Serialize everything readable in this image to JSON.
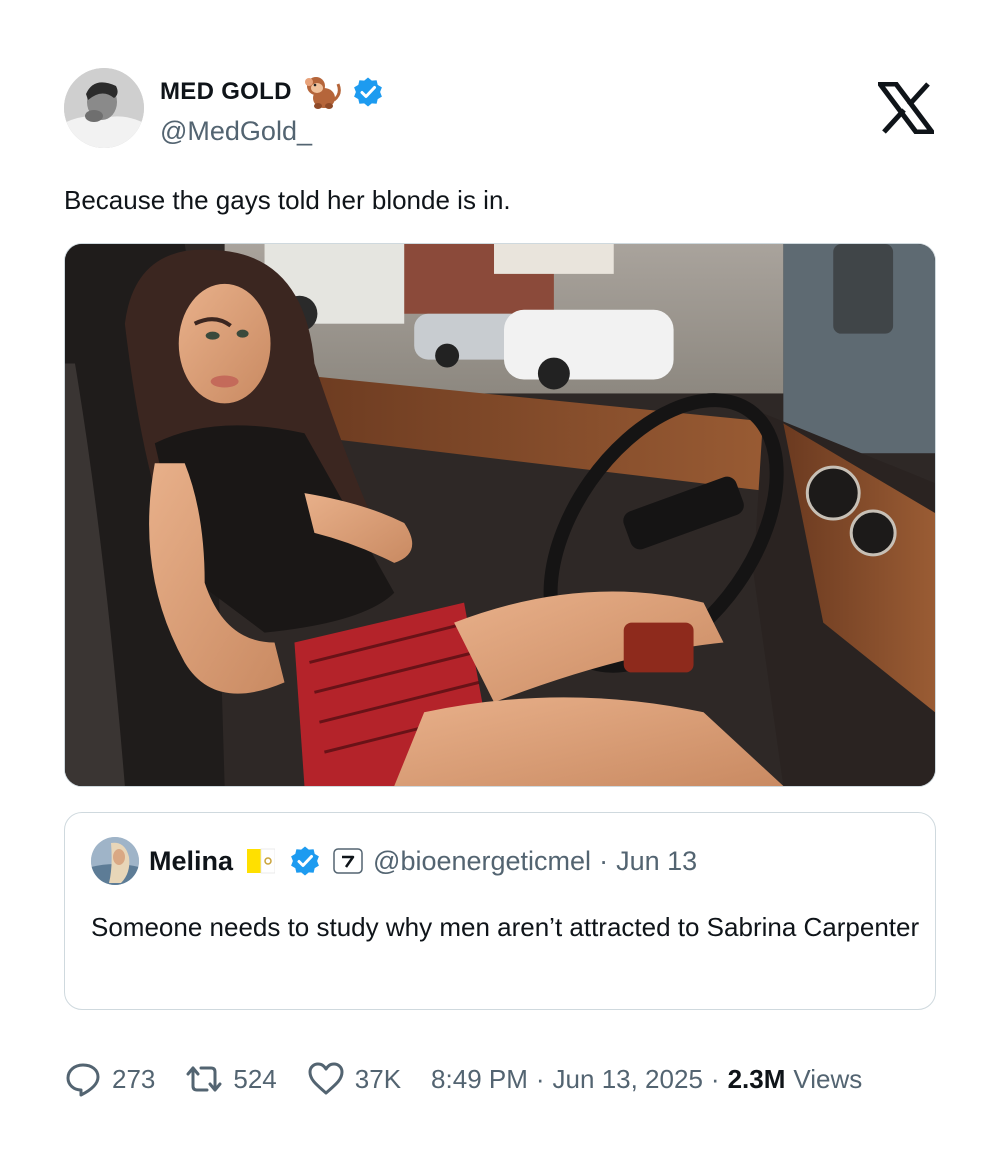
{
  "author": {
    "display_name": "MED GOLD",
    "handle": "@MedGold_",
    "badge_emoji_icon": "monkey-icon",
    "verified_icon": "verified-badge-icon",
    "verified_color": "#1d9bf0"
  },
  "platform_icon": "x-logo-icon",
  "tweet": {
    "text": "Because the gays told her blonde is in."
  },
  "quoted_tweet": {
    "display_name": "Melina",
    "flag_icon": "vatican-flag-icon",
    "verified_icon": "verified-badge-icon",
    "affiliation_icon": "affiliate-badge-icon",
    "handle": "@bioenergeticmel",
    "separator": "·",
    "date": "Jun 13",
    "text": "Someone needs to study why men aren’t attracted to Sabrina Carpenter"
  },
  "stats": {
    "replies": "273",
    "retweets": "524",
    "likes": "37K",
    "time": "8:49 PM",
    "separator": "·",
    "date": "Jun 13, 2025",
    "views_count": "2.3M",
    "views_label": "Views"
  },
  "colors": {
    "text": "#0f1419",
    "secondary": "#536471",
    "border": "#cfd9de",
    "accent": "#1d9bf0"
  }
}
